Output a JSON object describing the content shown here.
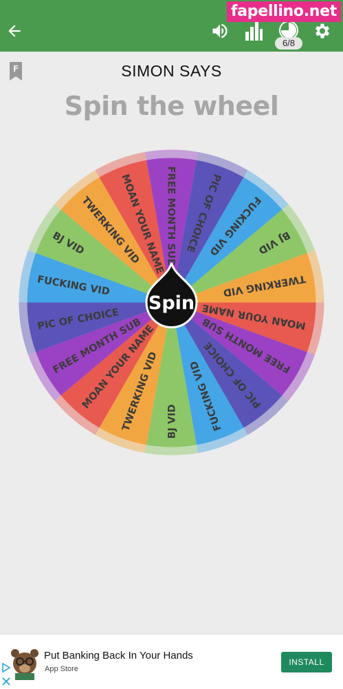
{
  "watermark": "fapellino.net",
  "toolbar": {
    "back_icon": "arrow-left-icon",
    "volume_icon": "volume-icon",
    "stats_icon": "bar-chart-icon",
    "progress_icon": "pie-chart-icon",
    "progress_text": "6/8",
    "progress_fraction": 0.75,
    "settings_icon": "gear-icon",
    "color": "#4a9b4e"
  },
  "page": {
    "flag_icon": "bookmark-f-icon",
    "flag_letter": "F",
    "title": "SIMON SAYS",
    "heading": "Spin the wheel"
  },
  "wheel": {
    "spin_label": "Spin",
    "segments": [
      {
        "label": "BJ VID",
        "color": "#9b42c4"
      },
      {
        "label": "TWERKING VID",
        "color": "#5a54b8"
      },
      {
        "label": "MOAN YOUR NAME",
        "color": "#44a6e6"
      },
      {
        "label": "FREE MONTH SUB",
        "color": "#8ec768"
      },
      {
        "label": "PIC OF CHOICE",
        "color": "#f2a641"
      },
      {
        "label": "FUCKING VID",
        "color": "#e85a4f"
      },
      {
        "label": "BJ VID",
        "color": "#9b42c4"
      },
      {
        "label": "TWERKING VID",
        "color": "#5a54b8"
      },
      {
        "label": "MOAN YOUR NAME",
        "color": "#44a6e6"
      },
      {
        "label": "FREE MONTH SUB",
        "color": "#8ec768"
      },
      {
        "label": "PIC OF CHOICE",
        "color": "#f2a641"
      },
      {
        "label": "FUCKING VID",
        "color": "#e85a4f"
      },
      {
        "label": "BJ VID",
        "color": "#9b42c4"
      },
      {
        "label": "TWERKING VID",
        "color": "#5a54b8"
      },
      {
        "label": "MOAN YOUR NAME",
        "color": "#44a6e6"
      },
      {
        "label": "FREE MONTH SUB",
        "color": "#8ec768"
      },
      {
        "label": "PIC OF CHOICE",
        "color": "#f2a641"
      },
      {
        "label": "FUCKING VID",
        "color": "#e85a4f"
      }
    ]
  },
  "ad": {
    "title": "Put Banking Back In Your Hands",
    "source": "App Store",
    "install_label": "INSTALL",
    "install_color": "#1f8a5e",
    "avatar_icon": "bear-with-glasses-icon",
    "adchoices_icon": "adchoices-triangle-icon",
    "close_icon": "close-icon"
  }
}
